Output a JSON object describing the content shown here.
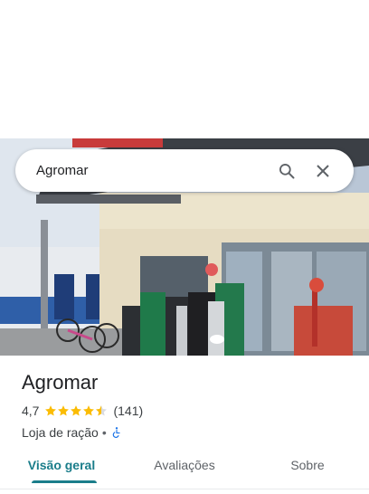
{
  "search": {
    "query": "Agromar"
  },
  "place": {
    "name": "Agromar",
    "rating": "4,7",
    "stars": 4.5,
    "review_count": "(141)",
    "category": "Loja de ração",
    "separator": "•"
  },
  "tabs": [
    {
      "label": "Visão geral",
      "active": true
    },
    {
      "label": "Avaliações",
      "active": false
    },
    {
      "label": "Sobre",
      "active": false
    }
  ],
  "colors": {
    "accent": "#1a7d8a",
    "star": "#fbbc04",
    "accessibility": "#1a73e8"
  },
  "icons": {
    "search": "search-icon",
    "close": "close-icon",
    "accessibility": "wheelchair-icon"
  }
}
